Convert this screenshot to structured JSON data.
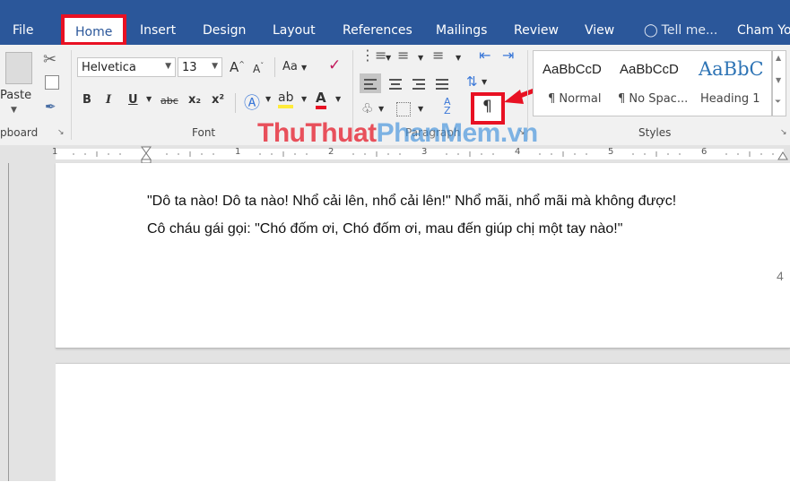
{
  "tabs": {
    "file": "File",
    "home": "Home",
    "insert": "Insert",
    "design": "Design",
    "layout": "Layout",
    "references": "References",
    "mailings": "Mailings",
    "review": "Review",
    "view": "View",
    "tell_me": "Tell me...",
    "user": "Cham Yo"
  },
  "clipboard": {
    "paste_label": "Paste",
    "group_label": "pboard"
  },
  "font": {
    "name": "Helvetica",
    "size": "13",
    "change_case": "Aa",
    "bold": "B",
    "italic": "I",
    "underline": "U",
    "strike": "abc",
    "subscript": "x₂",
    "superscript": "x²",
    "group_label": "Font"
  },
  "paragraph": {
    "show_marks": "¶",
    "group_label": "Paragraph"
  },
  "styles": {
    "items": [
      {
        "preview": "AaBbCcD",
        "name": "¶ Normal"
      },
      {
        "preview": "AaBbCcD",
        "name": "¶ No Spac..."
      },
      {
        "preview": "AaBbC",
        "name": "Heading 1"
      }
    ],
    "group_label": "Styles"
  },
  "ruler": {
    "numbers": [
      "1",
      "1",
      "2",
      "3",
      "4",
      "5",
      "6"
    ]
  },
  "document": {
    "line1": "\"Dô ta nào! Dô ta nào! Nhổ cải lên, nhổ cải lên!\" Nhổ mãi, nhổ mãi mà không được!",
    "line2": "Cô cháu gái gọi: \"Chó đốm ơi, Chó đốm ơi, mau đến giúp chị một tay nào!\"",
    "page_number": "4"
  },
  "watermark": {
    "part1": "ThuThuat",
    "part2": "PhanMem",
    "part3": ".vn"
  },
  "colors": {
    "ribbon_blue": "#2b579a",
    "highlight_red": "#e81123"
  }
}
